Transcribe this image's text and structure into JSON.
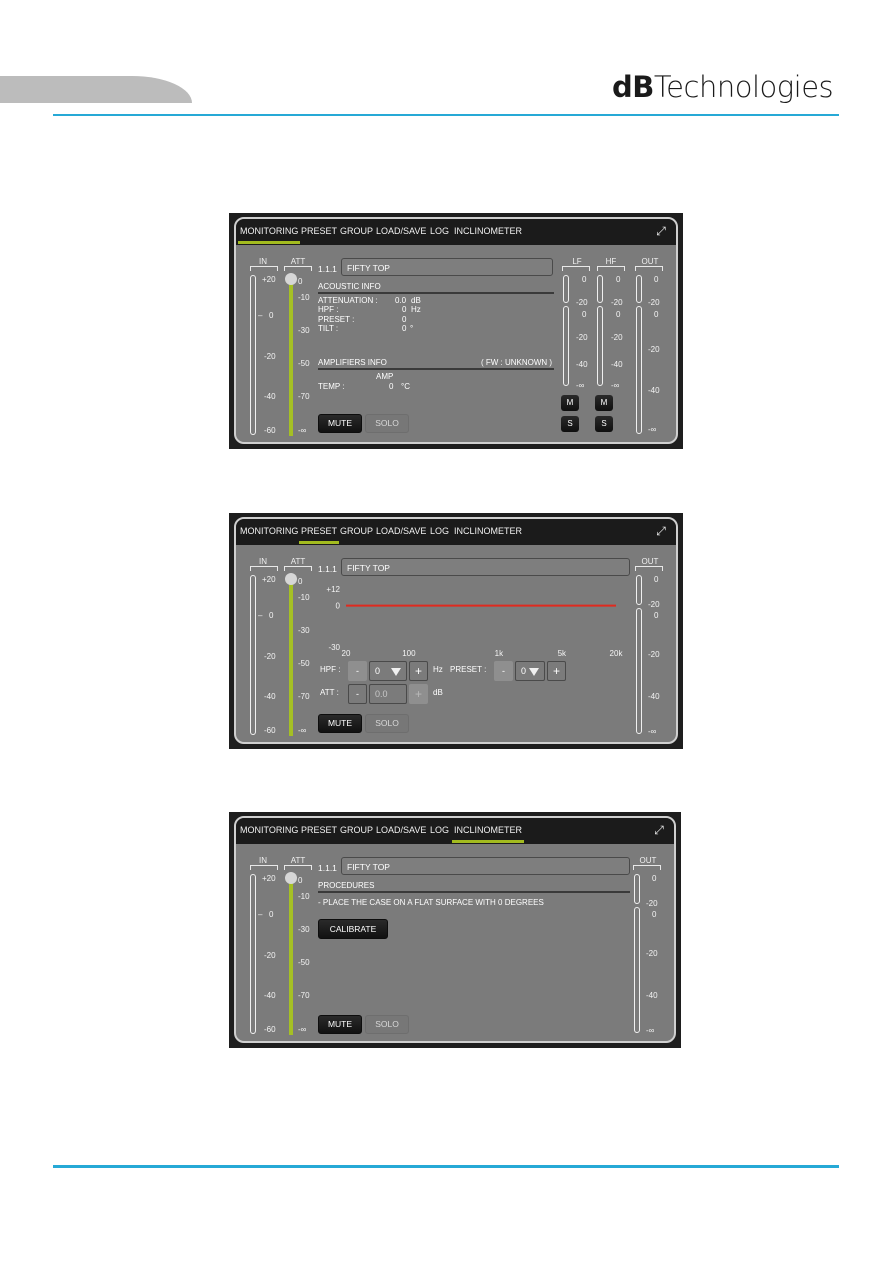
{
  "brand": {
    "bold": "dB",
    "light": "Technologies"
  },
  "tabs": [
    "MONITORING",
    "PRESET",
    "GROUP",
    "LOAD/SAVE",
    "LOG",
    "INCLINOMETER"
  ],
  "common": {
    "in_header": "IN",
    "att_header": "ATT",
    "out_header": "OUT",
    "lf_header": "LF",
    "hf_header": "HF",
    "in_scale": [
      "+20",
      "0",
      "-20",
      "-40",
      "-60"
    ],
    "att_scale": [
      "0",
      "-10",
      "-30",
      "-50",
      "-70",
      "-∞"
    ],
    "att_level_db": 0,
    "out_top_scale": [
      "0",
      "-20"
    ],
    "out_scale": [
      "0",
      "-20",
      "-40",
      "-∞"
    ],
    "band_scale": [
      "0",
      "-20",
      "-40",
      "-∞"
    ],
    "address": "1.1.1",
    "speaker_name": "FIFTY TOP",
    "mute_label": "MUTE",
    "solo_label": "SOLO",
    "m_label": "M",
    "s_label": "S"
  },
  "monitoring": {
    "active_tab": "MONITORING",
    "acoustic_title": "ACOUSTIC INFO",
    "rows": [
      {
        "label": "ATTENUATION :",
        "value": "0.0",
        "unit": "dB"
      },
      {
        "label": "HPF :",
        "value": "0",
        "unit": "Hz"
      },
      {
        "label": "PRESET :",
        "value": "0",
        "unit": ""
      },
      {
        "label": "TILT :",
        "value": "0",
        "unit": "°"
      }
    ],
    "amp_title": "AMPLIFIERS INFO",
    "fw": "( FW : UNKNOWN )",
    "amp_col": "AMP",
    "temp_label": "TEMP :",
    "temp_value": "0",
    "temp_unit": "°C"
  },
  "preset": {
    "active_tab": "PRESET",
    "chart_data": {
      "type": "line",
      "title": "",
      "xlabel": "",
      "ylabel": "",
      "x_ticks": [
        "20",
        "100",
        "1k",
        "5k",
        "20k"
      ],
      "y_ticks": [
        "+12",
        "0",
        "-30"
      ],
      "ylim": [
        -30,
        12
      ],
      "xlim": [
        20,
        20000
      ],
      "x_scale": "log",
      "series": [
        {
          "name": "response",
          "color": "#e02a1f",
          "x": [
            20,
            20000
          ],
          "y": [
            0,
            0
          ]
        }
      ]
    },
    "hpf_label": "HPF :",
    "hpf_value": "0",
    "hpf_unit": "Hz",
    "preset_label": "PRESET :",
    "preset_value": "0",
    "att_label": "ATT :",
    "att_value": "0.0",
    "att_unit": "dB",
    "minus": "-",
    "plus": "+"
  },
  "inclinometer": {
    "active_tab": "INCLINOMETER",
    "procedures_title": "PROCEDURES",
    "instruction": "- PLACE THE CASE ON A FLAT SURFACE WITH 0 DEGREES",
    "calibrate_label": "CALIBRATE"
  }
}
